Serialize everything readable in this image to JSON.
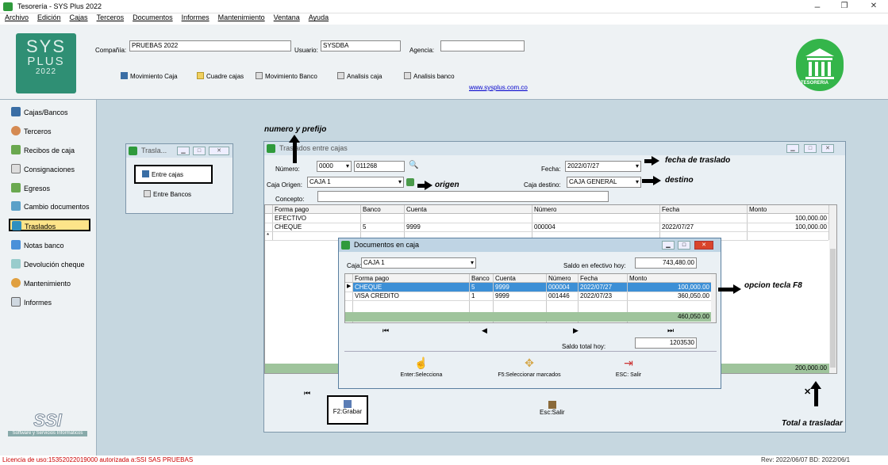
{
  "window": {
    "title": "Tesorería - SYS Plus 2022",
    "min": "–",
    "max": "❐",
    "close": "✕"
  },
  "menu": [
    "Archivo",
    "Edición",
    "Cajas",
    "Terceros",
    "Documentos",
    "Informes",
    "Mantenimiento",
    "Ventana",
    "Ayuda"
  ],
  "logo": {
    "line1": "SYS",
    "line2": "PLUS",
    "line3": "2022"
  },
  "header": {
    "company_label": "Compañía:",
    "company_value": "PRUEBAS 2022",
    "user_label": "Usuario:",
    "user_value": "SYSDBA",
    "agency_label": "Agencia:",
    "agency_value": "",
    "url": "www.sysplus.com.co",
    "tesoreria": "TESORERIA"
  },
  "toolbar": [
    "Movimiento Caja",
    "Cuadre cajas",
    "Movimiento Banco",
    "Analisis caja",
    "Analisis banco"
  ],
  "sidebar": [
    "Cajas/Bancos",
    "Terceros",
    "Recibos de caja",
    "Consignaciones",
    "Egresos",
    "Cambio documentos",
    "Traslados",
    "Notas banco",
    "Devolución cheque",
    "Mantenimiento",
    "Informes"
  ],
  "ssi": {
    "logo": "SSI",
    "sub": "Software y Servicios Informáticos"
  },
  "small_win": {
    "title": "Trasla...",
    "opt1": "Entre cajas",
    "opt2": "Entre Bancos"
  },
  "main_win": {
    "title": "Traslados entre cajas",
    "numero_label": "Número:",
    "numero_prefix": "0000",
    "numero_value": "011268",
    "fecha_label": "Fecha:",
    "fecha_value": "2022/07/27",
    "origen_label": "Caja Origen:",
    "origen_value": "CAJA 1",
    "destino_label": "Caja destino:",
    "destino_value": "CAJA GENERAL",
    "concepto_label": "Concepto:",
    "concepto_value": "",
    "columns": [
      "Forma pago",
      "Banco",
      "Cuenta",
      "Número",
      "Fecha",
      "Monto"
    ],
    "rows": [
      [
        "EFECTIVO",
        "",
        "",
        "",
        "",
        "100,000.00"
      ],
      [
        "CHEQUE",
        "5",
        "9999",
        "000004",
        "2022/07/27",
        "100,000.00"
      ]
    ],
    "total": "200,000.00",
    "grabar": "F2:Grabar",
    "salir": "Esc:Salir"
  },
  "docs_win": {
    "title": "Documentos en caja",
    "caja_label": "Caja:",
    "caja_value": "CAJA 1",
    "saldo_ef_label": "Saldo en efectivo hoy:",
    "saldo_ef_value": "743,480.00",
    "columns": [
      "Forma pago",
      "Banco",
      "Cuenta",
      "Número",
      "Fecha",
      "Monto"
    ],
    "rows": [
      [
        "CHEQUE",
        "5",
        "9999",
        "000004",
        "2022/07/27",
        "100,000.00"
      ],
      [
        "VISA CREDITO",
        "1",
        "9999",
        "001446",
        "2022/07/23",
        "360,050.00"
      ]
    ],
    "total": "460,050.00",
    "saldo_total_label": "Saldo total hoy:",
    "saldo_total_value": "1203530",
    "btn1": "Enter:Selecciona",
    "btn2": "F5:Seleccionar marcados",
    "btn3": "ESC: Salir"
  },
  "annotations": {
    "numero": "numero y prefijo",
    "fecha": "fecha de traslado",
    "origen": "origen",
    "destino": "destino",
    "f8": "opcion tecla F8",
    "total": "Total a trasladar"
  },
  "status": {
    "left": "Licencia de uso:15352022019000 autorizada a:SSI SAS PRUEBAS",
    "right": "Rev: 2022/06/07 BD: 2022/06/1"
  }
}
